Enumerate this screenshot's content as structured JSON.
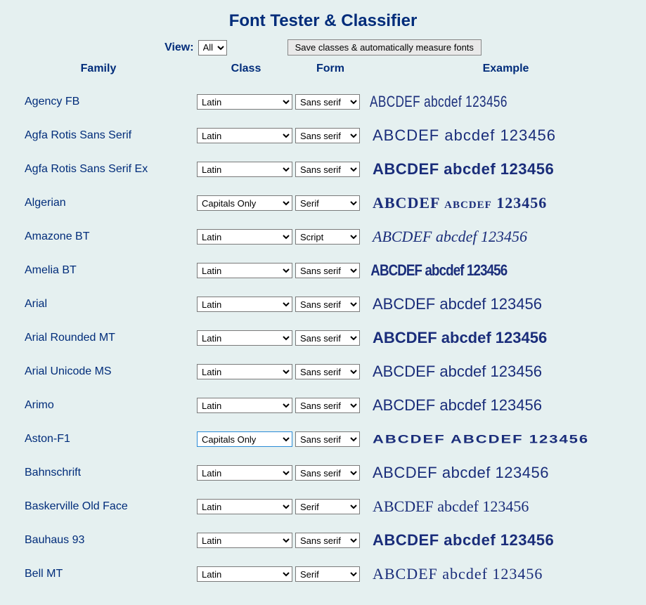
{
  "title": "Font Tester & Classifier",
  "controls": {
    "view_label": "View:",
    "view_value": "All",
    "save_button": "Save classes & automatically measure fonts"
  },
  "headers": {
    "family": "Family",
    "class": "Class",
    "form": "Form",
    "example": "Example"
  },
  "sample_text": "ABCDEF abcdef 123456",
  "fonts": [
    {
      "family": "Agency FB",
      "class": "Latin",
      "form": "Sans serif",
      "fx": "fx-agency"
    },
    {
      "family": "Agfa Rotis Sans Serif",
      "class": "Latin",
      "form": "Sans serif",
      "fx": "fx-rotis"
    },
    {
      "family": "Agfa Rotis Sans Serif Ex",
      "class": "Latin",
      "form": "Sans serif",
      "fx": "fx-rotisex"
    },
    {
      "family": "Algerian",
      "class": "Capitals Only",
      "form": "Serif",
      "fx": "fx-algerian"
    },
    {
      "family": "Amazone BT",
      "class": "Latin",
      "form": "Script",
      "fx": "fx-amazone"
    },
    {
      "family": "Amelia BT",
      "class": "Latin",
      "form": "Sans serif",
      "fx": "fx-amelia"
    },
    {
      "family": "Arial",
      "class": "Latin",
      "form": "Sans serif",
      "fx": "fx-arial"
    },
    {
      "family": "Arial Rounded MT",
      "class": "Latin",
      "form": "Sans serif",
      "fx": "fx-arialr"
    },
    {
      "family": "Arial Unicode MS",
      "class": "Latin",
      "form": "Sans serif",
      "fx": "fx-arialu"
    },
    {
      "family": "Arimo",
      "class": "Latin",
      "form": "Sans serif",
      "fx": "fx-arimo"
    },
    {
      "family": "Aston-F1",
      "class": "Capitals Only",
      "form": "Sans serif",
      "fx": "fx-aston",
      "active": true
    },
    {
      "family": "Bahnschrift",
      "class": "Latin",
      "form": "Sans serif",
      "fx": "fx-bahn"
    },
    {
      "family": "Baskerville Old Face",
      "class": "Latin",
      "form": "Serif",
      "fx": "fx-basker"
    },
    {
      "family": "Bauhaus 93",
      "class": "Latin",
      "form": "Sans serif",
      "fx": "fx-bauhaus"
    },
    {
      "family": "Bell MT",
      "class": "Latin",
      "form": "Serif",
      "fx": "fx-bell"
    }
  ]
}
